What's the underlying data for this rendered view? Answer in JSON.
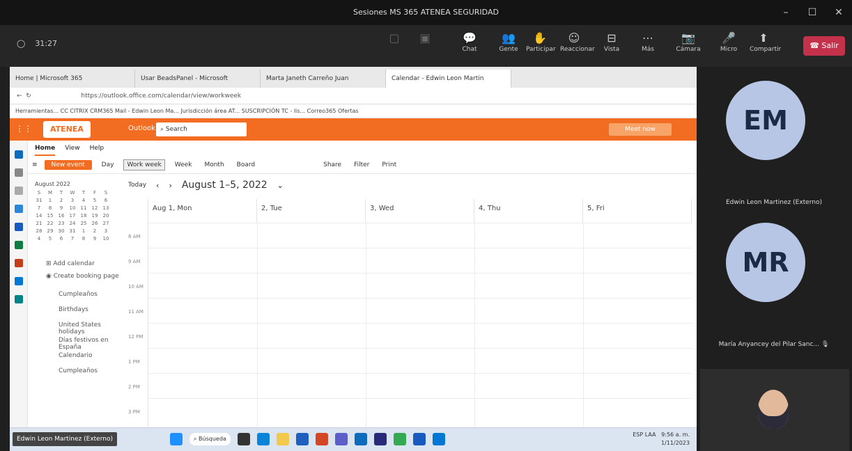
{
  "window": {
    "title": "Sesiones MS 365 ATENEA SEGURIDAD",
    "minimize": "–",
    "maximize": "☐",
    "close": "✕"
  },
  "meeting": {
    "timer": "31:27",
    "buttons": [
      {
        "label": "Chat",
        "icon": "chat-icon"
      },
      {
        "label": "Gente",
        "icon": "people-icon"
      },
      {
        "label": "Participar",
        "icon": "raise-hand-icon"
      },
      {
        "label": "Reaccionar",
        "icon": "reaction-icon"
      },
      {
        "label": "Vista",
        "icon": "view-icon"
      },
      {
        "label": "Más",
        "icon": "more-icon"
      },
      {
        "label": "Cámara",
        "icon": "camera-icon"
      },
      {
        "label": "Micro",
        "icon": "mic-icon"
      },
      {
        "label": "Compartir",
        "icon": "share-icon"
      }
    ],
    "leave_label": "Salir"
  },
  "browser": {
    "tabs": [
      "Home | Microsoft 365",
      "Usar BeadsPanel - Microsoft",
      "Marta Janeth Carreño Juan",
      "Calendar - Edwin Leon Martin"
    ],
    "address": "https://outlook.office.com/calendar/view/workweek",
    "favorites": "Herramientas... CC CITRIX CRM365 Mail - Edwin Leon Ma... Jurisdicción área AT... SUSCRIPCIÓN TC - lis... Correo365 Ofertas"
  },
  "outlook": {
    "logo": "ATENEA",
    "app": "Outlook",
    "search": "Search",
    "meet_now": "Meet now",
    "ribbon": [
      "Home",
      "View",
      "Help"
    ],
    "new_event": "New event",
    "toolbar": [
      "Day",
      "Work week",
      "Week",
      "Month",
      "Board",
      "Share",
      "Filter",
      "Print"
    ],
    "mini_month": "August 2022",
    "nav": [
      "Add calendar",
      "Create booking page",
      "Cumpleaños",
      "Birthdays",
      "United States holidays",
      "Días festivos en España",
      "Calendario",
      "Cumpleaños"
    ],
    "today": "Today",
    "range_title": "August 1–5, 2022",
    "days": [
      "Aug 1, Mon",
      "2, Tue",
      "3, Wed",
      "4, Thu",
      "5, Fri"
    ],
    "times": [
      "8 AM",
      "9 AM",
      "10 AM",
      "11 AM",
      "12 PM",
      "1 PM",
      "2 PM",
      "3 PM"
    ]
  },
  "taskbar": {
    "presenter": "Edwin Leon Martinez (Externo)",
    "search": "Búsqueda",
    "tray_lang": "ESP LAA",
    "tray_time": "9:56 a. m.",
    "tray_date": "1/11/2023"
  },
  "participants": [
    {
      "initials": "EM",
      "name": "Edwin Leon Martinez (Externo)"
    },
    {
      "initials": "MR",
      "name": "María Anyancey del Pilar Sanc..."
    }
  ]
}
